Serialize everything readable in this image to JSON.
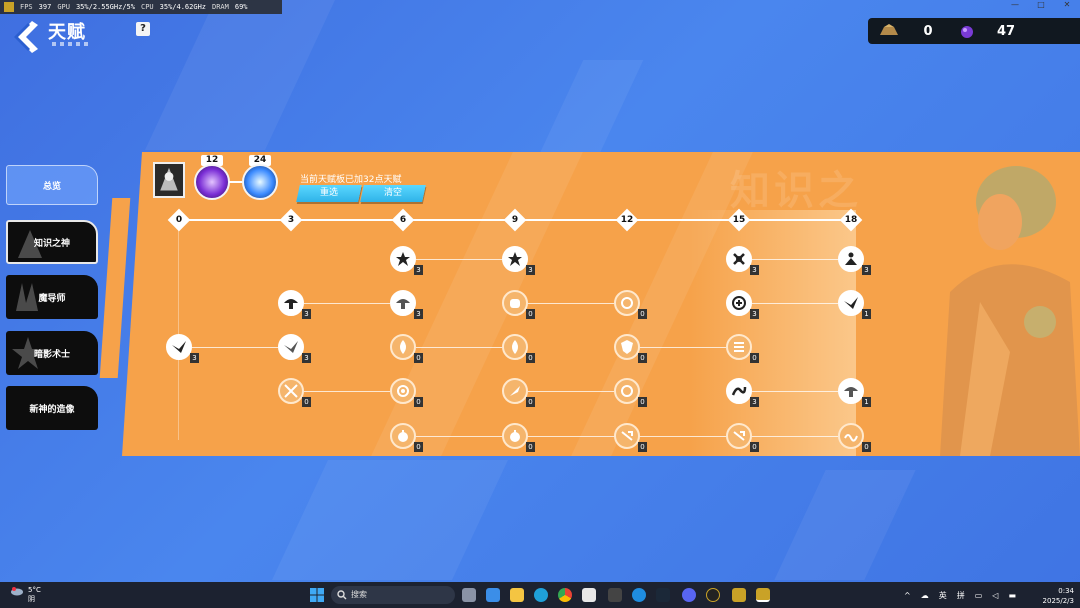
{
  "perf": {
    "fps_label": "FPS",
    "fps": "397",
    "gpu_label": "GPU",
    "gpu": "35%/2.55GHz/5%",
    "cpu_label": "CPU",
    "cpu": "35%/4.62GHz",
    "dram_label": "DRAM",
    "dram": "69%"
  },
  "window": {
    "minimize": "—",
    "maximize": "□",
    "close": "✕"
  },
  "header": {
    "title": "天赋",
    "help": "?"
  },
  "currency": [
    {
      "icon": "gold-ingot-icon",
      "value": "0"
    },
    {
      "icon": "purple-gem-icon",
      "value": "47"
    }
  ],
  "tabs": [
    {
      "label": "总览"
    },
    {
      "label": "知识之神"
    },
    {
      "label": "魔导师"
    },
    {
      "label": "暗影术士"
    },
    {
      "label": "新神的造像"
    }
  ],
  "panel": {
    "bg_text": "知识之",
    "counts": [
      "12",
      "24"
    ],
    "info": "当前天赋板已加32点天赋",
    "reset_label": "重选",
    "clear_label": "清空"
  },
  "tiers": [
    "0",
    "3",
    "6",
    "9",
    "12",
    "15",
    "18"
  ],
  "node_levels": {
    "r1": [
      "3",
      "3",
      "3",
      "3"
    ],
    "r2": [
      "3",
      "3",
      "0",
      "0",
      "3",
      "1"
    ],
    "r3": [
      "3",
      "3",
      "0",
      "0",
      "0",
      "0"
    ],
    "r4": [
      "0",
      "0",
      "0",
      "0",
      "3",
      "1"
    ],
    "r5": [
      "0",
      "0",
      "0",
      "0",
      "0"
    ]
  },
  "taskbar": {
    "temp": "5°C",
    "weather": "阴",
    "search": "搜索",
    "ime1": "英",
    "ime2": "拼",
    "time": "0:34",
    "date": "2025/2/3"
  },
  "colors": {
    "panel": "#f6a24a",
    "button": "#2fb3e8",
    "background": "#4a86ee"
  }
}
